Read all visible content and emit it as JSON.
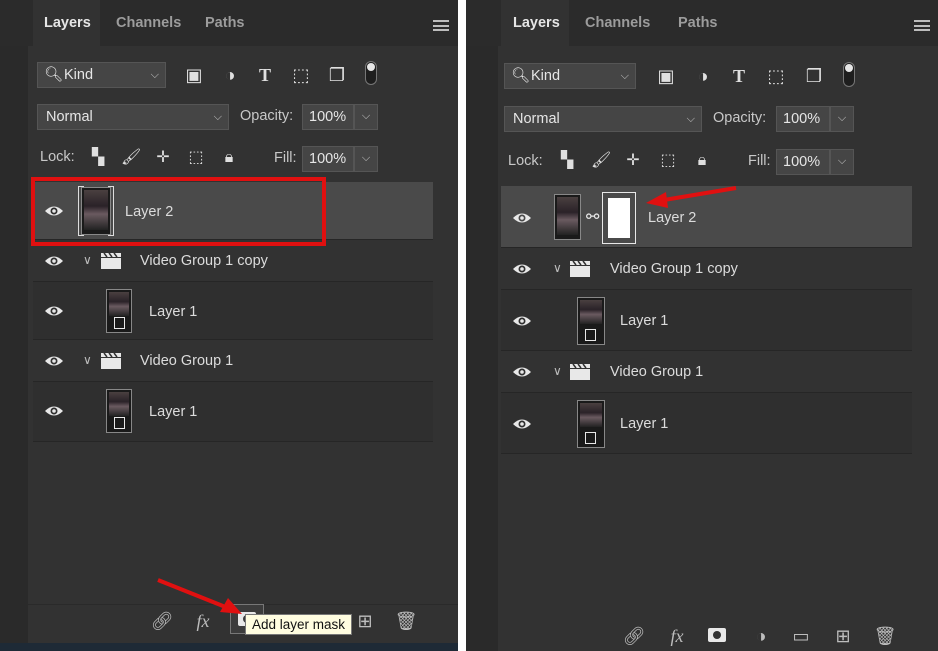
{
  "colors": {
    "accent_red": "#e01010",
    "panel_bg": "#323232",
    "selected_row": "#4a4a4a",
    "tooltip_bg": "#fffde0"
  },
  "left": {
    "tabs": [
      "Layers",
      "Channels",
      "Paths"
    ],
    "filter": {
      "kind": "Kind"
    },
    "blend": {
      "mode": "Normal",
      "opacity_label": "Opacity:",
      "opacity": "100%"
    },
    "lock": {
      "label": "Lock:",
      "fill_label": "Fill:",
      "fill": "100%"
    },
    "layers": [
      {
        "name": "Layer 2"
      },
      {
        "name": "Video Group 1 copy"
      },
      {
        "name": "Layer 1"
      },
      {
        "name": "Video Group 1"
      },
      {
        "name": "Layer 1"
      }
    ],
    "tooltip": "Add layer mask",
    "bottom_icons": [
      "link-icon",
      "fx-icon",
      "mask-icon",
      "adjustment-icon",
      "folder-icon",
      "new-layer-icon",
      "trash-icon"
    ]
  },
  "right": {
    "tabs": [
      "Layers",
      "Channels",
      "Paths"
    ],
    "filter": {
      "kind": "Kind"
    },
    "blend": {
      "mode": "Normal",
      "opacity_label": "Opacity:",
      "opacity": "100%"
    },
    "lock": {
      "label": "Lock:",
      "fill_label": "Fill:",
      "fill": "100%"
    },
    "layers": [
      {
        "name": "Layer 2"
      },
      {
        "name": "Video Group 1 copy"
      },
      {
        "name": "Layer 1"
      },
      {
        "name": "Video Group 1"
      },
      {
        "name": "Layer 1"
      }
    ],
    "bottom_icons": [
      "link-icon",
      "fx-icon",
      "mask-icon",
      "adjustment-icon",
      "folder-icon",
      "new-layer-icon",
      "trash-icon"
    ]
  }
}
